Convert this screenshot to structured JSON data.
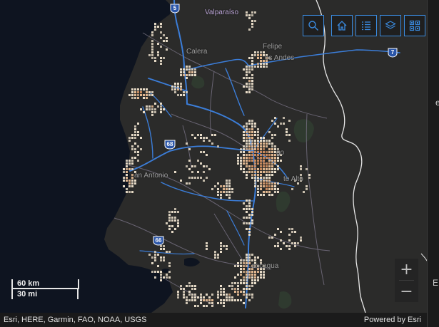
{
  "map": {
    "place_labels": [
      {
        "id": "valparaiso",
        "text": "Valparaíso"
      },
      {
        "id": "calera",
        "text": "Calera"
      },
      {
        "id": "felipe",
        "text": "Felipe"
      },
      {
        "id": "los-andes",
        "text": "os Andes"
      },
      {
        "id": "santiago",
        "text": "go"
      },
      {
        "id": "san-antonio",
        "text": "an Antonio"
      },
      {
        "id": "puente-alto",
        "text": "te Alto"
      },
      {
        "id": "rancagua",
        "text": "ancagua"
      }
    ],
    "highways": [
      {
        "id": "5",
        "label": "5"
      },
      {
        "id": "7",
        "label": "7"
      },
      {
        "id": "68",
        "label": "68"
      },
      {
        "id": "66",
        "label": "66"
      }
    ],
    "colors": {
      "ocean": "#0e1420",
      "land": "#2b2b2a",
      "road": "#3b7dd8",
      "boundary": "#6f6a7a",
      "border": "#e8e8e8",
      "accent": "#3a8be0",
      "urban_light": "#e8dcc8",
      "urban_mid": "#e2b890",
      "urban_dark": "#c98a5e"
    }
  },
  "toolbar": {
    "search_icon": "search-icon",
    "home_icon": "home-icon",
    "legend_icon": "list-icon",
    "layers_icon": "layers-icon",
    "basemap_icon": "grid-icon"
  },
  "zoom": {
    "in_label": "+",
    "out_label": "−"
  },
  "scale": {
    "km": "60 km",
    "mi": "30 mi"
  },
  "attribution": {
    "left": "Esri, HERE, Garmin, FAO, NOAA, USGS",
    "right": "Powered by Esri"
  },
  "side_panel": {
    "top_char": "e",
    "bottom_char": "E"
  }
}
